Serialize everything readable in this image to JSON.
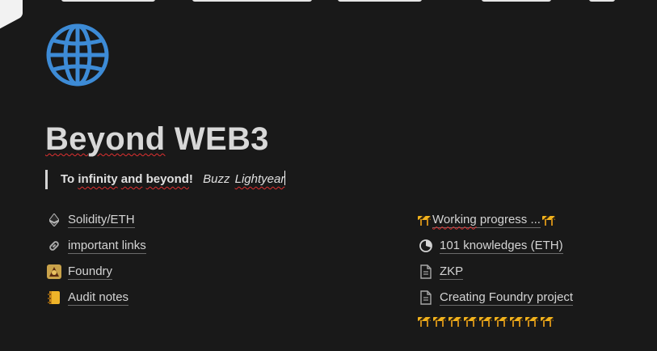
{
  "page": {
    "title_part1": "Beyond",
    "title_part2": "WEB3",
    "icon": "globe-icon"
  },
  "quote": {
    "text_a": "To",
    "text_b": "infinity",
    "text_c": "and",
    "text_d": "beyond",
    "text_e": "!",
    "author_a": "Buzz",
    "author_b": "Lightyear"
  },
  "left_links": [
    {
      "label": "Solidity/ETH",
      "icon": "ethereum-icon"
    },
    {
      "label": "important links",
      "icon": "link-icon"
    },
    {
      "label": "Foundry",
      "icon": "foundry-icon"
    },
    {
      "label": "Audit notes",
      "icon": "notebook-icon"
    }
  ],
  "right_links": [
    {
      "label_a": "Working",
      "label_b": "progress ...",
      "icon": "construction-icon"
    },
    {
      "label": "101 knowledges (ETH)",
      "icon": "progress-circle-icon"
    },
    {
      "label": "ZKP",
      "icon": "page-icon"
    },
    {
      "label": "Creating Foundry project",
      "icon": "page-icon"
    }
  ],
  "barrier_count": 9,
  "colors": {
    "background": "#191919",
    "text": "#d4d4d4",
    "globe": "#3d8bd6",
    "barrier": "#f1b21c",
    "spellcheck": "#e03030"
  }
}
